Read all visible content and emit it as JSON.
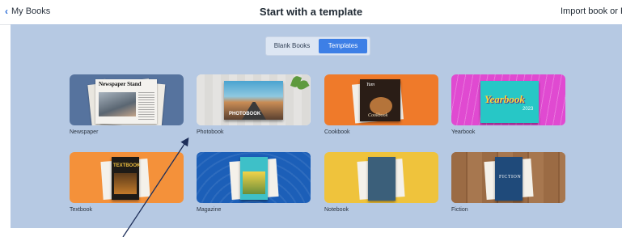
{
  "header": {
    "back_label": "My Books",
    "title": "Start with a template",
    "import_label": "Import book or PD"
  },
  "toggle": {
    "blank_label": "Blank Books",
    "templates_label": "Templates",
    "selected": "Templates"
  },
  "templates": [
    {
      "label": "Newspaper",
      "color": "#56739e"
    },
    {
      "label": "Photobook",
      "color": "#e9e8e6"
    },
    {
      "label": "Cookbook",
      "color": "#ef7a2a"
    },
    {
      "label": "Yearbook",
      "color": "#e04ad1"
    },
    {
      "label": "Textbook",
      "color": "#f4913a"
    },
    {
      "label": "Magazine",
      "color": "#1c5fb8"
    },
    {
      "label": "Notebook",
      "color": "#efc33c"
    },
    {
      "label": "Fiction",
      "color": "#9a6a45"
    }
  ],
  "thumbnails": {
    "newspaper_head": "Newspaper Stand",
    "photobook_text": "PHOTOBOOK",
    "cookbook_text": "Cookbook",
    "yearbook_text": "Yearbook",
    "yearbook_year": "2023",
    "textbook_text": "TEXTBOOK",
    "fiction_text": "FICTION"
  },
  "colors": {
    "accent": "#3d7fe6",
    "content_background": "#b6c9e3",
    "annotation_arrow": "#1e2f5a"
  }
}
